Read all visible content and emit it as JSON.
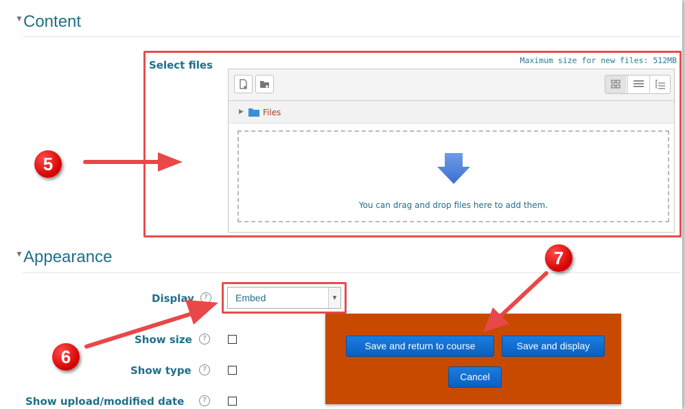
{
  "content": {
    "section_title": "Content",
    "select_files_label": "Select files",
    "max_size_text": "Maximum size for new files: 512MB",
    "path_folder_label": "Files",
    "drop_hint": "You can drag and drop files here to add them."
  },
  "appearance": {
    "section_title": "Appearance",
    "display_label": "Display",
    "display_value": "Embed",
    "show_size_label": "Show size",
    "show_type_label": "Show type",
    "show_date_label": "Show upload/modified date",
    "help_glyph": "?"
  },
  "actions": {
    "save_return_label": "Save and return to course",
    "save_display_label": "Save and display",
    "cancel_label": "Cancel"
  },
  "annotations": {
    "step5": "5",
    "step6": "6",
    "step7": "7"
  },
  "colors": {
    "accent": "#1f6f88",
    "annotation_red": "#e74c4c",
    "button_blue": "#0a6fd6",
    "panel_orange": "#c84a00"
  },
  "icons": [
    "add-file-icon",
    "create-folder-icon",
    "grid-view-icon",
    "list-view-icon",
    "tree-view-icon",
    "folder-icon",
    "expand-arrow-icon",
    "down-arrow-icon",
    "help-icon",
    "caret-down-icon"
  ]
}
